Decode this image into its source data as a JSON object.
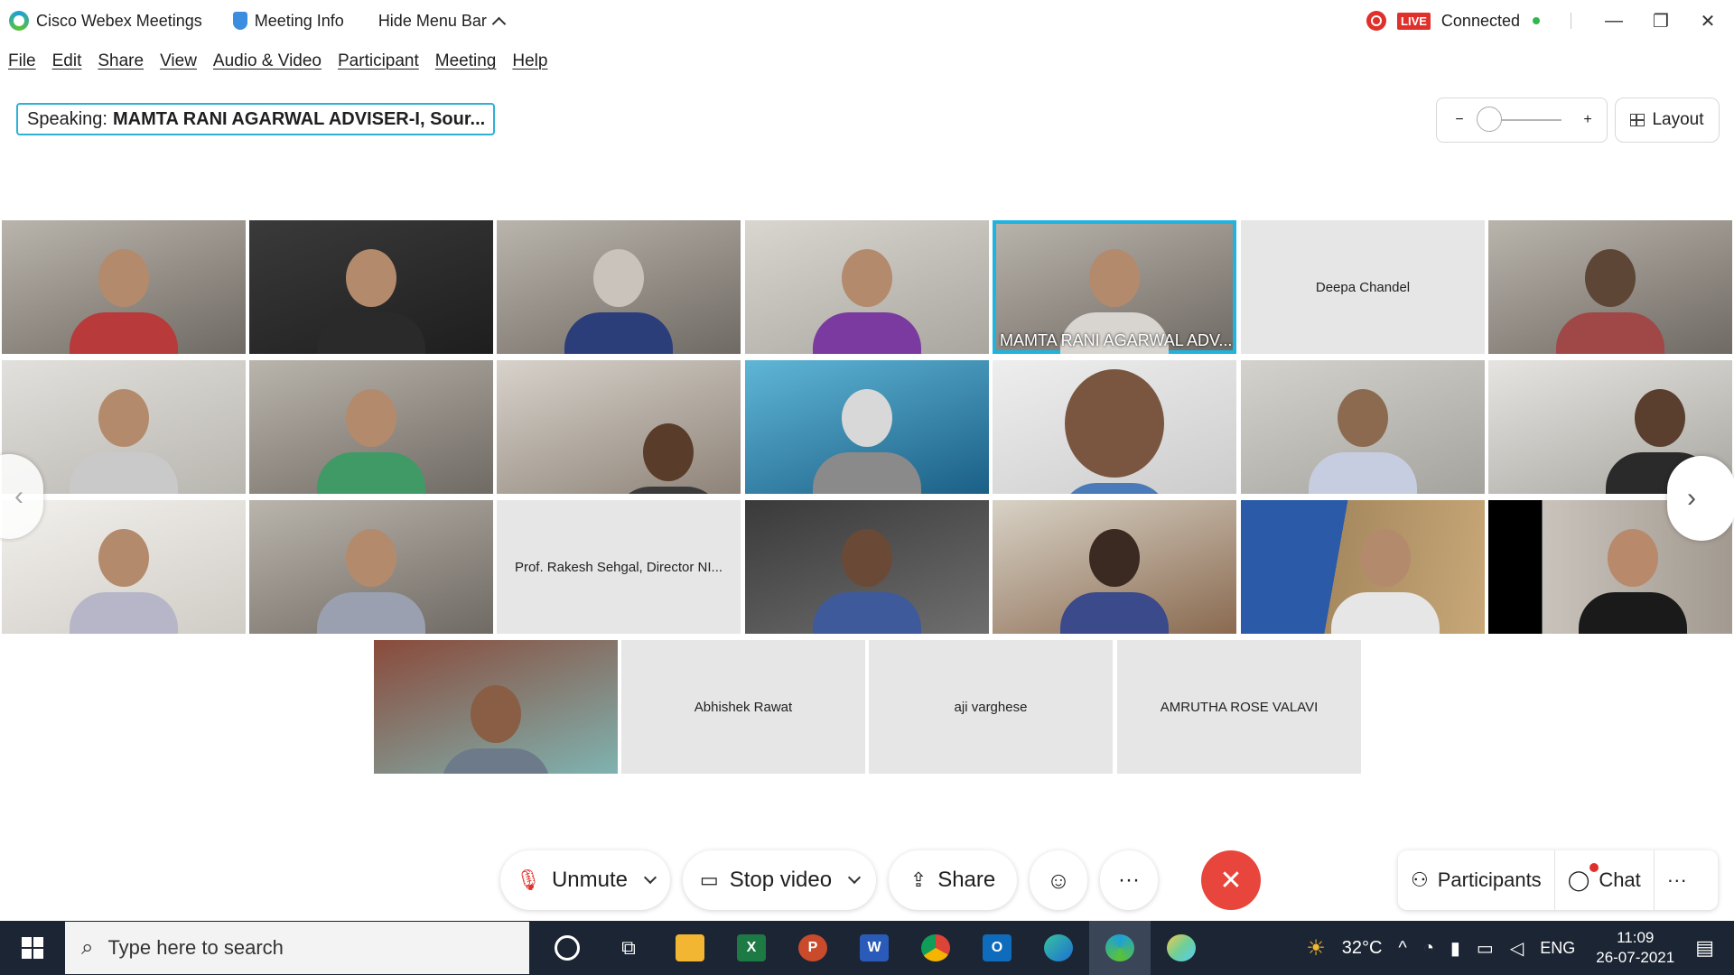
{
  "titlebar": {
    "app_name": "Cisco Webex Meetings",
    "meeting_info": "Meeting Info",
    "hide_menu": "Hide Menu Bar",
    "live_badge": "LIVE",
    "connection_status": "Connected",
    "minimize": "—",
    "restore": "❐",
    "close": "✕"
  },
  "menu": [
    "File",
    "Edit",
    "Share",
    "View",
    "Audio & Video",
    "Participant",
    "Meeting",
    "Help"
  ],
  "speaking": {
    "label": "Speaking:",
    "name": "MAMTA RANI AGARWAL ADVISER-I, Sour..."
  },
  "zoom": {
    "minus": "−",
    "plus": "+",
    "level": 0
  },
  "layout_label": "Layout",
  "active_caption": "MAMTA RANI AGARWAL ADV...",
  "names": {
    "deepa": "Deepa Chandel",
    "rakesh": "Prof. Rakesh Sehgal, Director NI...",
    "abhishek": "Abhishek Rawat",
    "aji": "aji varghese",
    "amrutha": "AMRUTHA ROSE VALAVI"
  },
  "controls": {
    "unmute": "Unmute",
    "stop_video": "Stop video",
    "share": "Share",
    "more": "···",
    "participants": "Participants",
    "chat": "Chat",
    "right_more": "···"
  },
  "taskbar": {
    "search_placeholder": "Type here to search",
    "weather": "32°C",
    "lang": "ENG",
    "time": "11:09",
    "date": "26-07-2021"
  },
  "colors": {
    "accent": "#1fb3e0",
    "end_call": "#e8453c",
    "live": "#e0302c",
    "taskbar": "#1c2533"
  }
}
